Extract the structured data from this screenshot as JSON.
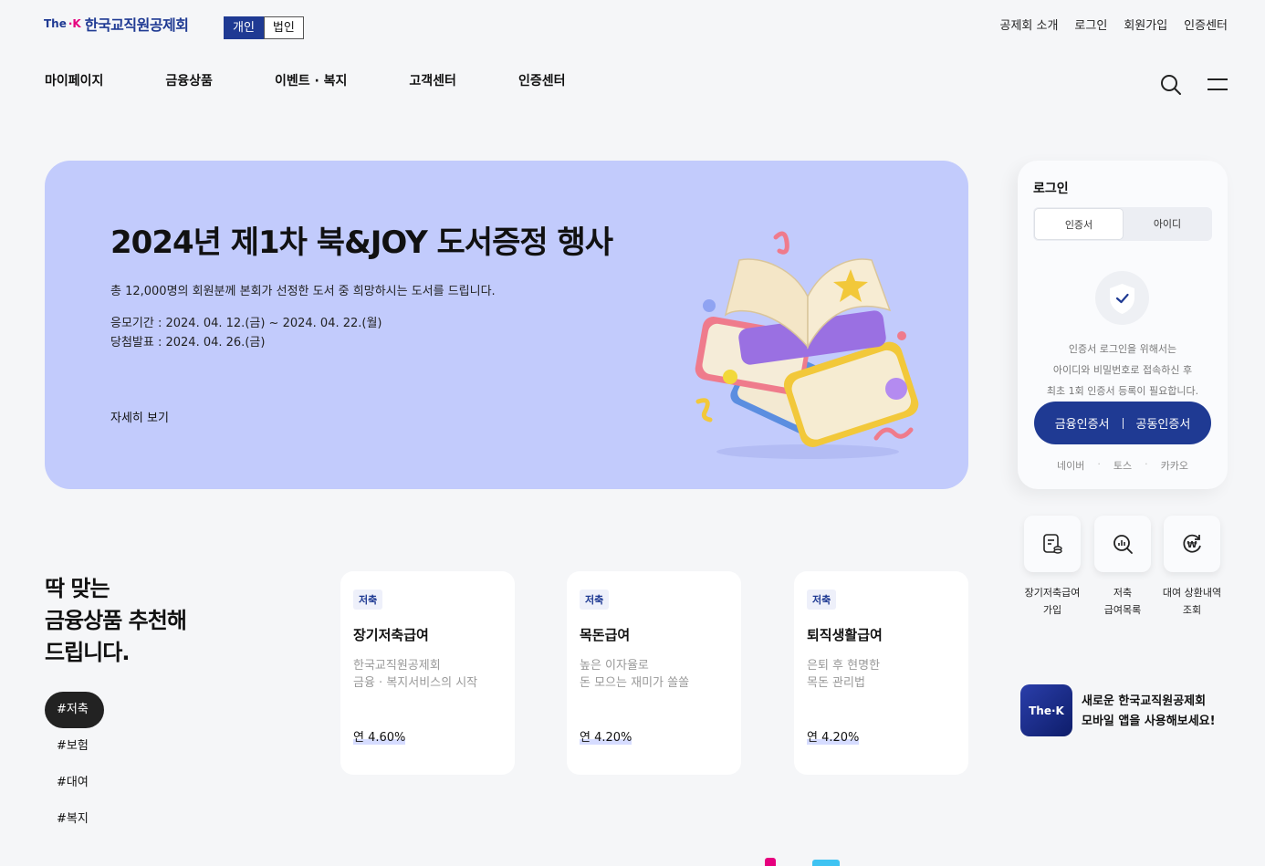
{
  "header": {
    "logo_prefix": "The",
    "logo_k": "·K",
    "logo_name": "한국교직원공제회",
    "member_types": [
      "개인",
      "법인"
    ],
    "utility_links": [
      "공제회 소개",
      "로그인",
      "회원가입",
      "인증센터"
    ],
    "gnb": [
      "마이페이지",
      "금융상품",
      "이벤트 · 복지",
      "고객센터",
      "인증센터"
    ]
  },
  "banner": {
    "title": "2024년 제1차 북&JOY 도서증정 행사",
    "description": "총 12,000명의 회원분께 본회가 선정한 도서 중 희망하시는 도서를 드립니다.",
    "period": "응모기간 : 2024. 04. 12.(금) ~ 2024. 04. 22.(월)",
    "announce": "당첨발표 : 2024. 04. 26.(금)",
    "more": "자세히 보기",
    "bg_color": "#c2cbfc"
  },
  "login": {
    "title": "로그인",
    "tabs": [
      "인증서",
      "아이디"
    ],
    "info_lines": [
      "인증서 로그인을 위해서는",
      "아이디와 비밀번호로 접속하신 후",
      "최초 1회 인증서 등록이 필요합니다."
    ],
    "cert_financial": "금융인증서",
    "cert_joint": "공동인증서",
    "social": [
      "네이버",
      "토스",
      "카카오"
    ],
    "social_sep": "·"
  },
  "quick_menu": [
    {
      "line1": "장기저축급여",
      "line2": "가입",
      "icon": "document-coin-icon"
    },
    {
      "line1": "저축",
      "line2": "급여목록",
      "icon": "search-chart-icon"
    },
    {
      "line1": "대여 상환내역",
      "line2": "조회",
      "icon": "won-cycle-icon"
    }
  ],
  "recommend": {
    "title_lines": [
      "딱 맞는",
      "금융상품 추천해",
      "드립니다."
    ],
    "tags": [
      "#저축",
      "#보험",
      "#대여",
      "#복지"
    ],
    "cards": [
      {
        "badge": "저축",
        "title": "장기저축급여",
        "desc": "한국교직원공제회\n금융 · 복지서비스의 시작",
        "rate": "연 4.60%"
      },
      {
        "badge": "저축",
        "title": "목돈급여",
        "desc": "높은 이자율로\n돈 모으는 재미가 쏠쏠",
        "rate": "연 4.20%"
      },
      {
        "badge": "저축",
        "title": "퇴직생활급여",
        "desc": "은퇴 후 현명한\n목돈 관리법",
        "rate": "연 4.20%"
      }
    ]
  },
  "app_promo": {
    "icon_text": "The·K",
    "line1": "새로운 한국교직원공제회",
    "line2": "모바일 앱을 사용해보세요!"
  },
  "colors": {
    "brand": "#1f3a93",
    "accent": "#e6007e"
  }
}
